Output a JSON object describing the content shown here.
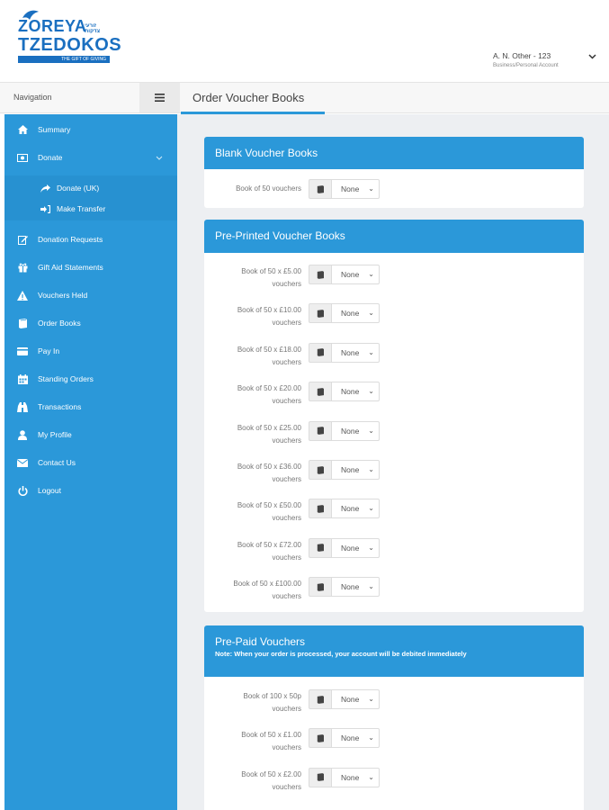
{
  "logo": {
    "line1": "ZOREYA",
    "hebrew": "זורעי צדקות",
    "line2": "TZEDOKOS",
    "tagline": "THE GIFT OF GIVING"
  },
  "user": {
    "name": "A. N. Other - 123",
    "account_type": "Business/Personal Account"
  },
  "subbar": {
    "nav_label": "Navigation",
    "menu_icon": "hamburger-icon",
    "page_title": "Order Voucher Books"
  },
  "sidebar": {
    "items": [
      {
        "label": "Summary",
        "icon": "home-icon"
      },
      {
        "label": "Donate",
        "icon": "money-icon"
      },
      {
        "label": "Donate (UK)",
        "icon": "share-icon"
      },
      {
        "label": "Make Transfer",
        "icon": "sign-in-icon"
      },
      {
        "label": "Donation Requests",
        "icon": "edit-icon"
      },
      {
        "label": "Gift Aid Statements",
        "icon": "gift-icon"
      },
      {
        "label": "Vouchers Held",
        "icon": "warning-icon"
      },
      {
        "label": "Order Books",
        "icon": "book-icon"
      },
      {
        "label": "Pay In",
        "icon": "card-icon"
      },
      {
        "label": "Standing Orders",
        "icon": "calendar-icon"
      },
      {
        "label": "Transactions",
        "icon": "binoculars-icon"
      },
      {
        "label": "My Profile",
        "icon": "user-icon"
      },
      {
        "label": "Contact Us",
        "icon": "envelope-icon"
      },
      {
        "label": "Logout",
        "icon": "power-icon"
      }
    ]
  },
  "panels": {
    "blank": {
      "title": "Blank Voucher Books",
      "rows": [
        {
          "l1": "Book of 50 vouchers",
          "l2": "",
          "value": "None"
        }
      ]
    },
    "preprinted": {
      "title": "Pre-Printed Voucher Books",
      "rows": [
        {
          "l1": "Book of 50 x £5.00",
          "l2": "vouchers",
          "value": "None"
        },
        {
          "l1": "Book of 50 x £10.00",
          "l2": "vouchers",
          "value": "None"
        },
        {
          "l1": "Book of 50 x £18.00",
          "l2": "vouchers",
          "value": "None"
        },
        {
          "l1": "Book of 50 x £20.00",
          "l2": "vouchers",
          "value": "None"
        },
        {
          "l1": "Book of 50 x £25.00",
          "l2": "vouchers",
          "value": "None"
        },
        {
          "l1": "Book of 50 x £36.00",
          "l2": "vouchers",
          "value": "None"
        },
        {
          "l1": "Book of 50 x £50.00",
          "l2": "vouchers",
          "value": "None"
        },
        {
          "l1": "Book of 50 x £72.00",
          "l2": "vouchers",
          "value": "None"
        },
        {
          "l1": "Book of 50 x £100.00",
          "l2": "vouchers",
          "value": "None"
        }
      ]
    },
    "prepaid": {
      "title": "Pre-Paid Vouchers",
      "note": "Note: When your order is processed, your account will be debited immediately",
      "rows": [
        {
          "l1": "Book of 100 x 50p",
          "l2": "vouchers",
          "value": "None"
        },
        {
          "l1": "Book of 50 x £1.00",
          "l2": "vouchers",
          "value": "None"
        },
        {
          "l1": "Book of 50 x £2.00",
          "l2": "vouchers",
          "value": "None"
        }
      ]
    }
  },
  "colors": {
    "accent": "#2b98d9",
    "logo": "#1a6fc0",
    "background": "#edeff2"
  }
}
